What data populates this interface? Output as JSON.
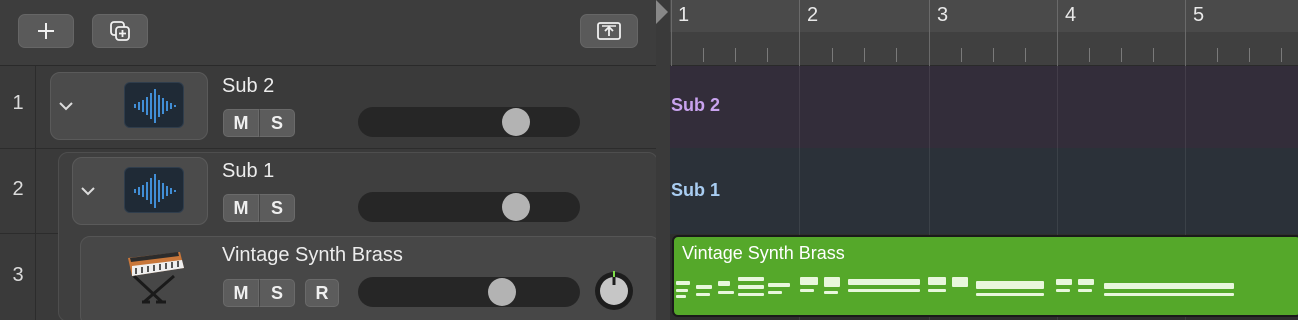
{
  "toolbar": {
    "add_icon": "plus-icon",
    "duplicate_icon": "duplicate-track-icon",
    "catch_icon": "upload-icon"
  },
  "tracks": [
    {
      "number": "1",
      "name": "Sub 2",
      "mute": "M",
      "solo": "S",
      "volume": 0.72,
      "type": "summing-stack",
      "icon": "waveform-icon"
    },
    {
      "number": "2",
      "name": "Sub 1",
      "mute": "M",
      "solo": "S",
      "volume": 0.72,
      "type": "summing-stack",
      "icon": "waveform-icon"
    },
    {
      "number": "3",
      "name": "Vintage Synth Brass",
      "mute": "M",
      "solo": "S",
      "record": "R",
      "volume": 0.65,
      "type": "software-instrument",
      "icon": "synthesizer-icon"
    }
  ],
  "ruler": {
    "bars": [
      "1",
      "2",
      "3",
      "4",
      "5"
    ]
  },
  "lanes": [
    {
      "label": "Sub 2",
      "color": "#c9a3ef",
      "bg": "#332d3a"
    },
    {
      "label": "Sub 1",
      "color": "#a9cdf2",
      "bg": "#2b3139"
    }
  ],
  "region": {
    "name": "Vintage Synth Brass",
    "color": "#55a82a"
  },
  "colors": {
    "region_notes": "#e8f7dc",
    "panel": "#3a3a3a"
  }
}
